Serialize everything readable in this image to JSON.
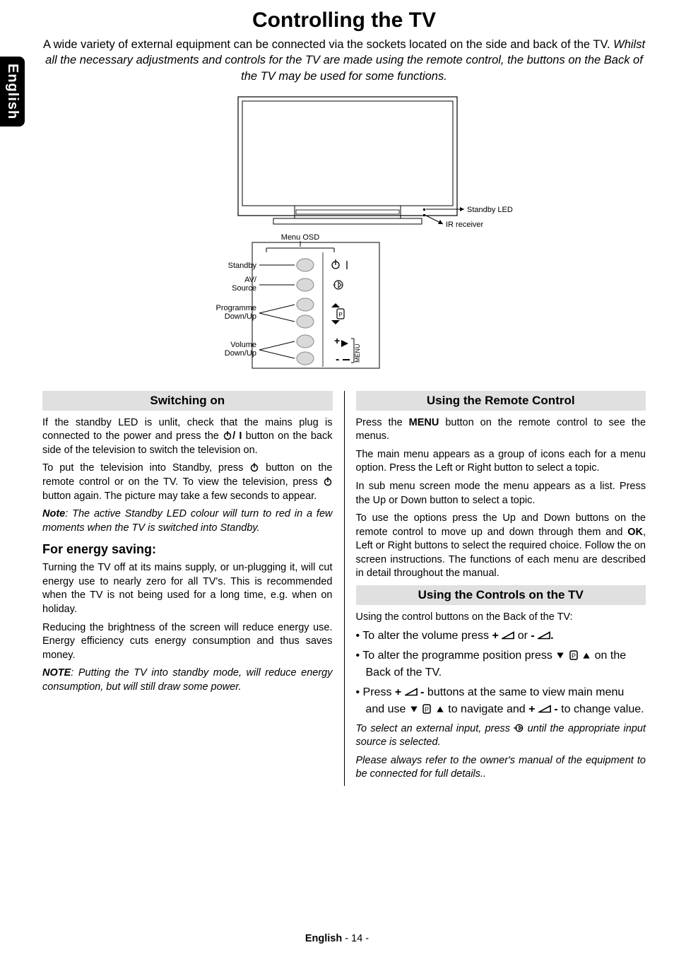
{
  "lang_tab": "English",
  "title": "Controlling the TV",
  "intro_plain": "A wide variety of external equipment can be connected via the sockets located on the side and back of the TV. ",
  "intro_italic": "Whilst all the necessary adjustments and controls for the TV are made using the remote control, the buttons on the Back of the TV  may be used for some functions.",
  "diagram": {
    "labels": {
      "menu_osd": "Menu OSD",
      "standby": "Standby",
      "av_source_l1": "AV/",
      "av_source_l2": "Source",
      "prog_l1": "Programme",
      "prog_l2": "Down/Up",
      "vol_l1": "Volume",
      "vol_l2": "Down/Up",
      "std_led": "Standby LED",
      "ir": "IR receiver",
      "menu_vert": "MENU"
    }
  },
  "left": {
    "hdr1": "Switching on",
    "p1a": "If the standby LED is unlit, check that the mains plug is connected to the power and press the ",
    "p1b": "/ I",
    "p1c": " button on the back side of the television to switch the television on.",
    "p2a": "To put the television into Standby, press ",
    "p2b": " button on the remote control or on the TV. To view the television, press ",
    "p2c": " button again. The picture may take a few seconds to appear.",
    "p3": "Note",
    "p3b": ": The active Standby LED colour will turn to red in a few moments when the TV is switched into Standby.",
    "sub1": "For energy saving:",
    "p4": "Turning the TV off at its mains supply, or un-plugging it, will cut energy use to nearly zero for all TV's. This is recommended when the TV is not being used for a long time, e.g. when on holiday.",
    "p5": "Reducing the brightness of the screen will reduce energy use. Energy efficiency cuts energy consumption and thus saves money.",
    "p6a": "NOTE",
    "p6b": ": Putting the TV into standby mode, will reduce energy consumption, but will still draw some power."
  },
  "right": {
    "hdr1": "Using the Remote Control",
    "p1a": "Press the ",
    "p1b": "MENU",
    "p1c": " button on the remote control to see the menus.",
    "p2": "The main menu appears as a group of icons each for a menu option. Press the Left or Right button to select a topic.",
    "p3": "In sub menu screen mode the menu appears as a list. Press the Up or Down button to select a topic.",
    "p4a": "To use the options press the Up and Down buttons on the remote control to move up and down through them and ",
    "p4b": "OK",
    "p4c": ", Left or Right buttons to select the required choice. Follow the on screen instructions. The functions of each menu are described in detail throughout the manual.",
    "hdr2": "Using the Controls on the TV",
    "p5": "Using the control buttons on the Back of the TV:",
    "li1a": "To alter the volume press ",
    "li1b": "+",
    "li1c": " or ",
    "li1d": "-",
    "li1e": ".",
    "li2a": "To alter the programme position press ",
    "li2b": " on the Back of the TV.",
    "li3a": "Press ",
    "li3b": "+",
    "li3c": " - ",
    "li3d": "buttons at the same to view main menu and use ",
    "li3e": " to navigate and ",
    "li3f": "+",
    "li3g": " - ",
    "li3h": "to change value.",
    "p6a": "To select an external input, press ",
    "p6b": "  until the appropriate input source is selected.",
    "p7": "Please always refer to the owner's manual of the equipment to be connected for full details.."
  },
  "footer": {
    "lang": "English",
    "sep": "   - ",
    "page": "14",
    "tail": " -"
  }
}
